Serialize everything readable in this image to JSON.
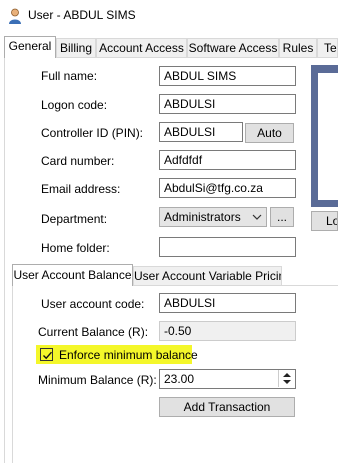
{
  "window": {
    "title": "User - ABDUL SIMS",
    "icon": "user-icon"
  },
  "tabs": [
    {
      "label": "General",
      "active": true
    },
    {
      "label": "Billing"
    },
    {
      "label": "Account Access"
    },
    {
      "label": "Software Access"
    },
    {
      "label": "Rules"
    },
    {
      "label": "Te"
    }
  ],
  "general": {
    "full_name_label": "Full name:",
    "full_name_value": "ABDUL SIMS",
    "logon_code_label": "Logon code:",
    "logon_code_value": "ABDULSI",
    "controller_id_label": "Controller ID (PIN):",
    "controller_id_value": "ABDULSI",
    "auto_button": "Auto",
    "card_number_label": "Card number:",
    "card_number_value": "Adfdfdf",
    "email_label": "Email address:",
    "email_value": "AbdulSi@tfg.co.za",
    "department_label": "Department:",
    "department_value": "Administrators",
    "department_browse": "...",
    "home_folder_label": "Home folder:",
    "home_folder_value": "",
    "photo_button_partial": "Lo"
  },
  "subtabs": [
    {
      "label": "User Account Balance",
      "active": true
    },
    {
      "label": "User Account Variable Pricing"
    }
  ],
  "balance": {
    "account_code_label": "User account code:",
    "account_code_value": "ABDULSI",
    "current_balance_label": "Current Balance (R):",
    "current_balance_value": "-0.50",
    "enforce_label": "Enforce minimum balance",
    "enforce_checked": true,
    "min_balance_label": "Minimum Balance (R):",
    "min_balance_value": "23.00",
    "add_transaction_button": "Add Transaction"
  },
  "colors": {
    "highlight": "#f4f72a",
    "photo_frame": "#5a6b97"
  }
}
